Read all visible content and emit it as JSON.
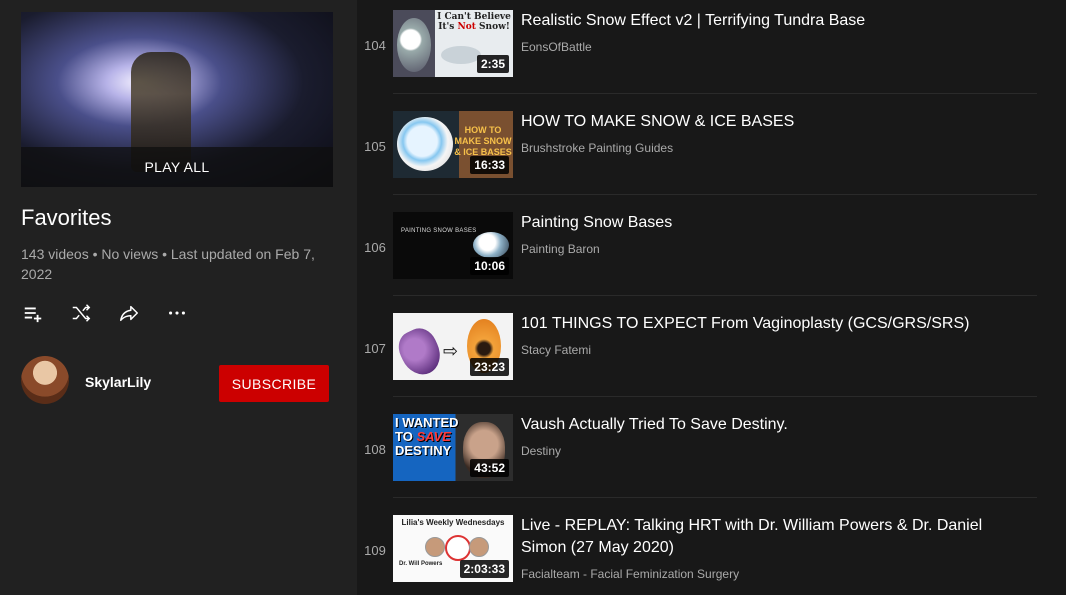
{
  "sidebar": {
    "play_all": "PLAY ALL",
    "title": "Favorites",
    "stats": "143 videos • No views • Last updated on Feb 7, 2022",
    "actions": {
      "add_icon": "playlist-add-icon",
      "shuffle_icon": "shuffle-icon",
      "share_icon": "share-icon",
      "more_icon": "more-horizontal-icon"
    },
    "owner": {
      "name": "SkylarLily",
      "subscribe_label": "SUBSCRIBE"
    }
  },
  "colors": {
    "background": "#181818",
    "sidebar_bg": "#212121",
    "subscribe": "#cc0000",
    "secondary_text": "#aaaaaa"
  },
  "videos": [
    {
      "index": "104",
      "title": "Realistic Snow Effect v2 | Terrifying Tundra Base",
      "channel": "EonsOfBattle",
      "duration": "2:35",
      "thumb_text": [
        "I Can't Believe",
        "It's ",
        "Not",
        " Snow!"
      ]
    },
    {
      "index": "105",
      "title": "HOW TO MAKE SNOW & ICE BASES",
      "channel": "Brushstroke Painting Guides",
      "duration": "16:33",
      "thumb_text": "HOW TO MAKE SNOW & ICE BASES"
    },
    {
      "index": "106",
      "title": "Painting Snow Bases",
      "channel": "Painting Baron",
      "duration": "10:06",
      "thumb_text": "PAINTING SNOW BASES"
    },
    {
      "index": "107",
      "title": "101 THINGS TO EXPECT From Vaginoplasty (GCS/GRS/SRS)",
      "channel": "Stacy Fatemi",
      "duration": "23:23",
      "thumb_text": ""
    },
    {
      "index": "108",
      "title": "Vaush Actually Tried To Save Destiny.",
      "channel": "Destiny",
      "duration": "43:52",
      "thumb_text": [
        "I WANTED",
        "TO ",
        "SAVE",
        "DESTINY"
      ]
    },
    {
      "index": "109",
      "title": "Live - REPLAY: Talking HRT with Dr. William Powers & Dr. Daniel Simon (27 May 2020)",
      "channel": "Facialteam - Facial Feminization Surgery",
      "duration": "2:03:33",
      "thumb_text": [
        "Lilia's Weekly Wednesdays",
        "Dr. Will Powers"
      ]
    }
  ]
}
